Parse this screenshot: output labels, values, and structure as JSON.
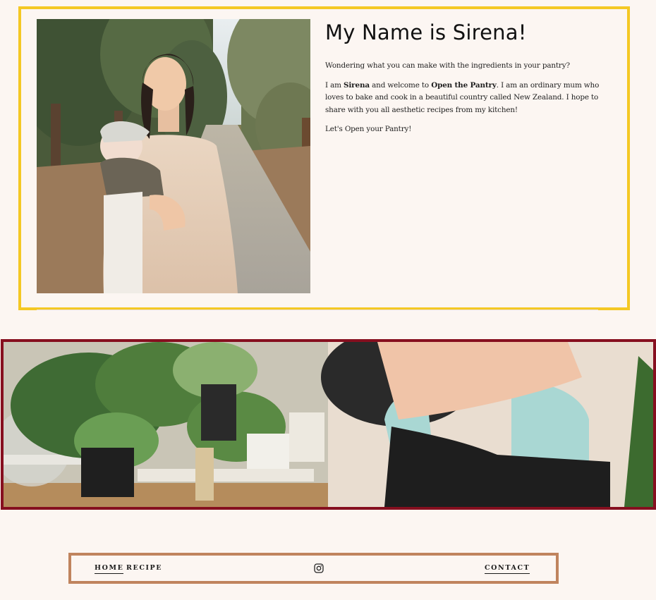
{
  "about": {
    "title": "My Name is Sirena!",
    "intro": "Wondering what you can make with the ingredients in your pantry?",
    "bio_prefix": "I am ",
    "bio_name": "Sirena",
    "bio_middle": " and welcome to ",
    "bio_brand": "Open the Pantry",
    "bio_suffix": ". I am an ordinary mum who loves to bake and cook in a beautiful country called New Zealand. I hope to share with you all aesthetic recipes from my kitchen!",
    "closing": "Let's Open your Pantry!"
  },
  "nav": {
    "home": "HOME",
    "recipe": "RECIPE",
    "contact": "CONTACT",
    "instagram_icon": "instagram-icon"
  },
  "colors": {
    "background": "#fcf6f2",
    "about_border": "#f4c824",
    "banner_border": "#860f1f",
    "footer_border": "#c0845e"
  }
}
